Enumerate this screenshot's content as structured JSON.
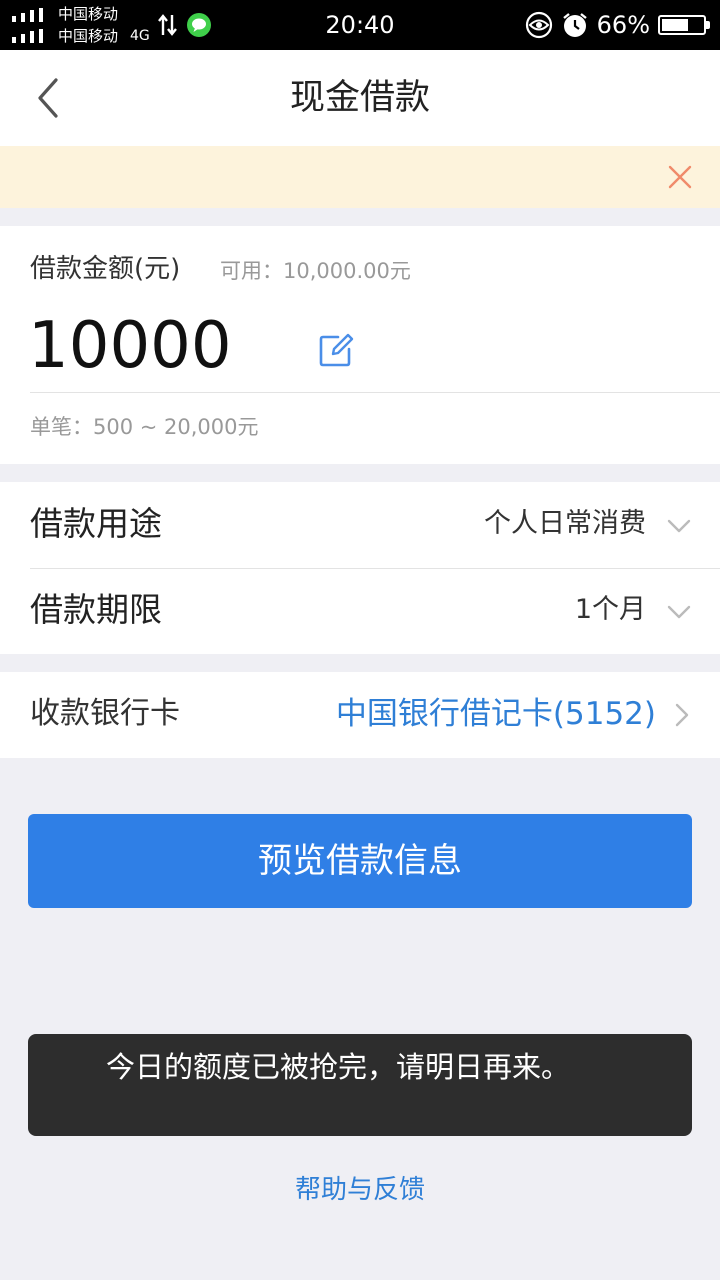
{
  "status_bar": {
    "carrier_1": "中国移动",
    "carrier_2": "中国移动",
    "network": "4G",
    "time": "20:40",
    "battery_pct": "66%",
    "battery_level": 0.66,
    "icons": [
      "signal-icon",
      "data-arrows-icon",
      "message-app-icon",
      "eye-protection-icon",
      "alarm-icon",
      "battery-icon"
    ]
  },
  "header": {
    "title": "现金借款",
    "back_icon": "chevron-left-icon"
  },
  "notice": {
    "close_icon": "close-icon"
  },
  "loan_amount": {
    "label": "借款金额(元)",
    "available": "可用：10,000.00元",
    "value": "10000",
    "edit_icon": "edit-icon",
    "range": "单笔：500 ~ 20,000元"
  },
  "loan_purpose": {
    "label": "借款用途",
    "value": "个人日常消费"
  },
  "loan_term": {
    "label": "借款期限",
    "value": "1个月"
  },
  "bank_card": {
    "label": "收款银行卡",
    "value": "中国银行借记卡(5152)"
  },
  "preview_button": "预览借款信息",
  "toast": "今日的额度已被抢完，请明日再来。",
  "help_link": "帮助与反馈",
  "colors": {
    "accent": "#2f7fe6",
    "link": "#2f7fd6",
    "notice_bg": "#fdf3dc",
    "close_icon": "#f08a6a",
    "page_bg": "#efeff4",
    "toast_bg": "#2d2d2d"
  }
}
